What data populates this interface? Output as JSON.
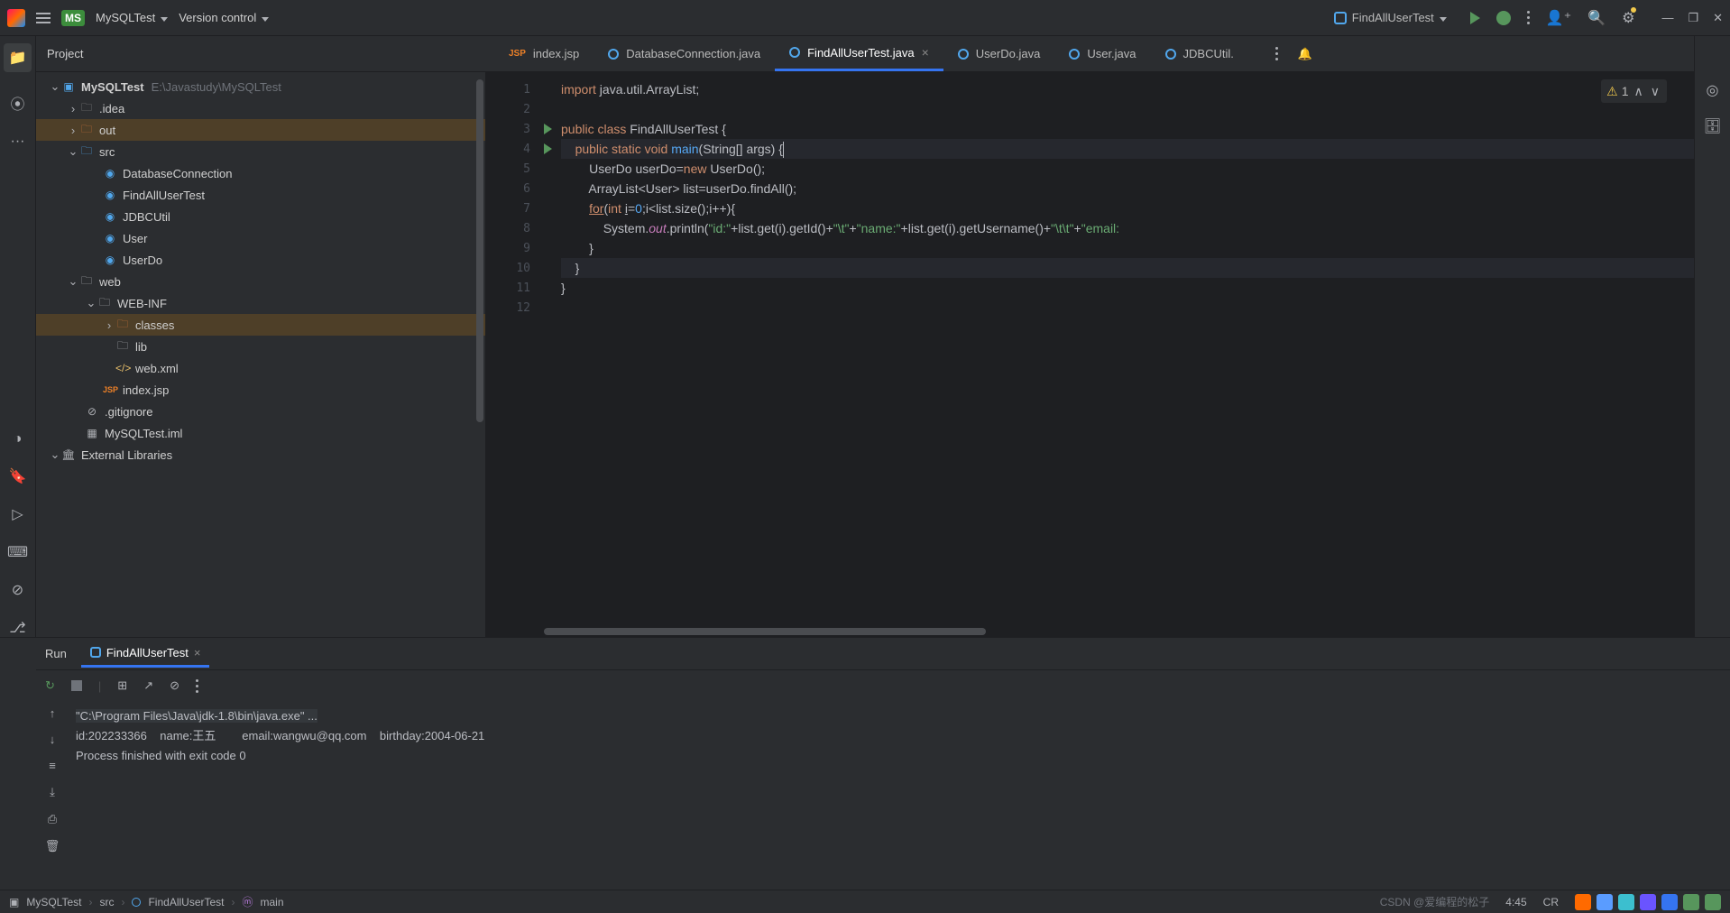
{
  "titlebar": {
    "project_short": "MS",
    "project": "MySQLTest",
    "vcs": "Version control",
    "run_config": "FindAllUserTest"
  },
  "sidebar": {
    "title": "Project",
    "root_name": "MySQLTest",
    "root_path": "E:\\Javastudy\\MySQLTest",
    "items": {
      "idea": ".idea",
      "out": "out",
      "src": "src",
      "databaseConnection": "DatabaseConnection",
      "findAllUserTest": "FindAllUserTest",
      "jdbcUtil": "JDBCUtil",
      "user": "User",
      "userDo": "UserDo",
      "web": "web",
      "webinf": "WEB-INF",
      "classes": "classes",
      "lib": "lib",
      "webxml": "web.xml",
      "indexjsp": "index.jsp",
      "gitignore": ".gitignore",
      "iml": "MySQLTest.iml",
      "extlib": "External Libraries"
    }
  },
  "tabs": {
    "t0": "index.jsp",
    "t1": "DatabaseConnection.java",
    "t2": "FindAllUserTest.java",
    "t3": "UserDo.java",
    "t4": "User.java",
    "t5": "JDBCUtil."
  },
  "editor": {
    "warn_count": "1",
    "lines": {
      "l1": [
        "import ",
        "java.util.ArrayList;"
      ],
      "l3_1": "public class ",
      "l3_2": "FindAllUserTest ",
      "l3_3": "{",
      "l4_1": "public static ",
      "l4_2": "void ",
      "l4_3": "main",
      "l4_4": "(String[] args) {",
      "l5_1": "UserDo userDo=",
      "l5_2": "new ",
      "l5_3": "UserDo();",
      "l6": "ArrayList<User> list=userDo.findAll();",
      "l7_1": "for",
      "l7_2": "(",
      "l7_3": "int ",
      "l7_4": "i",
      "l7_5": "=",
      "l7_6": "0",
      "l7_7": ";i<list.size();i++){",
      "l8_1": "System.",
      "l8_2": "out",
      "l8_3": ".println(",
      "l8_4": "\"id:\"",
      "l8_5": "+list.get(i).getId()+",
      "l8_6": "\"\\t\"",
      "l8_7": "+",
      "l8_8": "\"name:\"",
      "l8_9": "+list.get(i).getUsername()+",
      "l8_10": "\"\\t\\t\"",
      "l8_11": "+",
      "l8_12": "\"email:",
      "l9": "}",
      "l10": "}",
      "l11": "}"
    },
    "line_numbers": [
      "1",
      "2",
      "3",
      "4",
      "5",
      "6",
      "7",
      "8",
      "9",
      "10",
      "11",
      "12"
    ]
  },
  "run": {
    "label": "Run",
    "tab": "FindAllUserTest",
    "cmd": "\"C:\\Program Files\\Java\\jdk-1.8\\bin\\java.exe\" ...",
    "out1": "id:202233366    name:王五        email:wangwu@qq.com    birthday:2004-06-21",
    "out2": "Process finished with exit code 0"
  },
  "breadcrumb": {
    "b0": "MySQLTest",
    "b1": "src",
    "b2": "FindAllUserTest",
    "b3": "main"
  },
  "status": {
    "pos": "4:45",
    "enc": "CR",
    "watermark": "CSDN @爱编程的松子"
  }
}
